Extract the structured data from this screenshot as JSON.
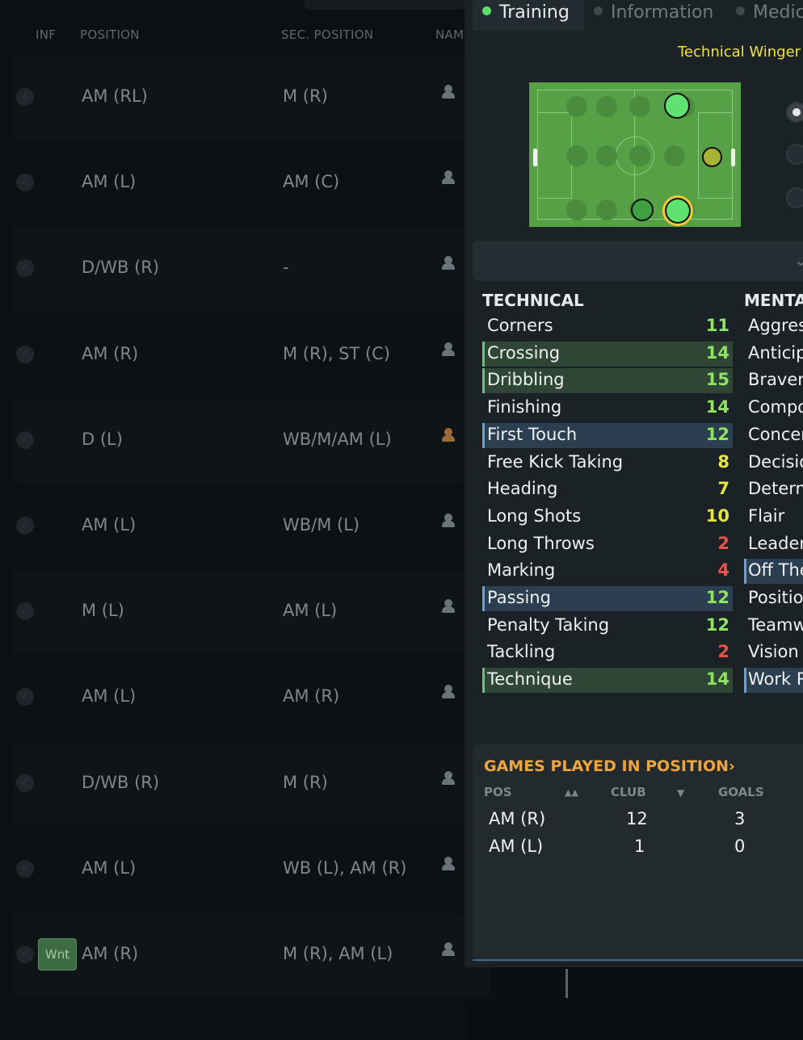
{
  "table": {
    "headers": {
      "inf": "INF",
      "position": "POSITION",
      "sec_position": "SEC. POSITION",
      "name": "NAM"
    },
    "rows": [
      {
        "position": "AM (RL)",
        "sec_position": "M (R)",
        "tag": ""
      },
      {
        "position": "AM (L)",
        "sec_position": "AM (C)",
        "tag": ""
      },
      {
        "position": "D/WB (R)",
        "sec_position": "-",
        "tag": ""
      },
      {
        "position": "AM (R)",
        "sec_position": "M (R), ST (C)",
        "tag": ""
      },
      {
        "position": "D (L)",
        "sec_position": "WB/M/AM (L)",
        "tag": ""
      },
      {
        "position": "AM (L)",
        "sec_position": "WB/M (L)",
        "tag": ""
      },
      {
        "position": "M (L)",
        "sec_position": "AM (L)",
        "tag": ""
      },
      {
        "position": "AM (L)",
        "sec_position": "AM (R)",
        "tag": ""
      },
      {
        "position": "D/WB (R)",
        "sec_position": "M (R)",
        "tag": ""
      },
      {
        "position": "AM (L)",
        "sec_position": "WB (L), AM (R)",
        "tag": ""
      },
      {
        "position": "AM (R)",
        "sec_position": "M (R), AM (L)",
        "tag": "Wnt"
      }
    ]
  },
  "panel": {
    "tabs": [
      {
        "label": "Training",
        "active": true
      },
      {
        "label": "Information",
        "active": false
      },
      {
        "label": "Medic",
        "active": false
      }
    ],
    "role": "Technical Winger",
    "technical_header": "TECHNICAL",
    "mental_header": "MENTA",
    "technical": [
      {
        "name": "Corners",
        "value": "11",
        "hl": ""
      },
      {
        "name": "Crossing",
        "value": "14",
        "hl": "green"
      },
      {
        "name": "Dribbling",
        "value": "15",
        "hl": "green"
      },
      {
        "name": "Finishing",
        "value": "14",
        "hl": ""
      },
      {
        "name": "First Touch",
        "value": "12",
        "hl": "blue"
      },
      {
        "name": "Free Kick Taking",
        "value": "8",
        "hl": ""
      },
      {
        "name": "Heading",
        "value": "7",
        "hl": ""
      },
      {
        "name": "Long Shots",
        "value": "10",
        "hl": ""
      },
      {
        "name": "Long Throws",
        "value": "2",
        "hl": ""
      },
      {
        "name": "Marking",
        "value": "4",
        "hl": ""
      },
      {
        "name": "Passing",
        "value": "12",
        "hl": "blue"
      },
      {
        "name": "Penalty Taking",
        "value": "12",
        "hl": ""
      },
      {
        "name": "Tackling",
        "value": "2",
        "hl": ""
      },
      {
        "name": "Technique",
        "value": "14",
        "hl": "green"
      }
    ],
    "mental": [
      {
        "name": "Aggres",
        "hl": ""
      },
      {
        "name": "Anticip",
        "hl": ""
      },
      {
        "name": "Braver",
        "hl": ""
      },
      {
        "name": "Compo",
        "hl": ""
      },
      {
        "name": "Concer",
        "hl": ""
      },
      {
        "name": "Decisio",
        "hl": ""
      },
      {
        "name": "Detern",
        "hl": ""
      },
      {
        "name": "Flair",
        "hl": ""
      },
      {
        "name": "Leader",
        "hl": ""
      },
      {
        "name": "Off The",
        "hl": "blue"
      },
      {
        "name": "Positio",
        "hl": ""
      },
      {
        "name": "Teamw",
        "hl": ""
      },
      {
        "name": "Vision",
        "hl": ""
      },
      {
        "name": "Work R",
        "hl": "blue"
      }
    ],
    "games": {
      "title": "GAMES PLAYED IN POSITION",
      "title_chevron": "›",
      "headers": {
        "pos": "POS",
        "club": "CLUB",
        "goals": "GOALS"
      },
      "sort_icons": {
        "pos": "▲▲",
        "club": "▼"
      },
      "rows": [
        {
          "pos": "AM (R)",
          "club": "12",
          "goals": "3"
        },
        {
          "pos": "AM (L)",
          "club": "1",
          "goals": "0"
        }
      ]
    }
  },
  "colors": {
    "value_green": "#8fe265",
    "value_yellow": "#e4e449",
    "value_red": "#e5534b",
    "accent_orange": "#f0a53a",
    "role_yellow": "#f0e23a"
  }
}
